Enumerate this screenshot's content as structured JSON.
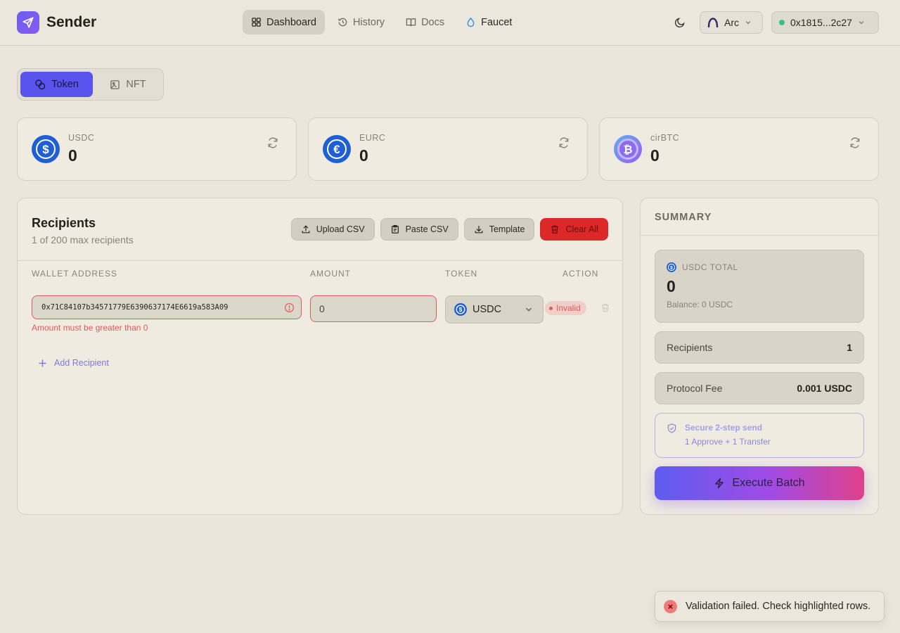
{
  "app": {
    "name": "Sender"
  },
  "nav": [
    {
      "label": "Dashboard",
      "icon": "grid-icon",
      "active": true
    },
    {
      "label": "History",
      "icon": "history-icon"
    },
    {
      "label": "Docs",
      "icon": "book-icon"
    },
    {
      "label": "Faucet",
      "icon": "droplet-icon"
    }
  ],
  "header": {
    "network": "Arc",
    "wallet": "0x1815...2c27",
    "wallet_status_color": "#34c77b"
  },
  "mode": {
    "token": "Token",
    "nft": "NFT",
    "selected": "Token"
  },
  "balances": [
    {
      "symbol": "USDC",
      "value": "0",
      "color": "#1f5fd6"
    },
    {
      "symbol": "EURC",
      "value": "0",
      "color": "#1f5fd6"
    },
    {
      "symbol": "cirBTC",
      "value": "0",
      "color": "#8a6cf0"
    }
  ],
  "recipients": {
    "title": "Recipients",
    "subtitle": "1 of 200 max recipients",
    "actions": {
      "upload": "Upload CSV",
      "paste": "Paste CSV",
      "template": "Template",
      "clear": "Clear All"
    },
    "columns": {
      "address": "WALLET ADDRESS",
      "amount": "AMOUNT",
      "token": "TOKEN",
      "action": "ACTION"
    },
    "rows": [
      {
        "address": "0x71C84107b34571779E6390637174E6619a583A09",
        "amount": "0",
        "token": "USDC",
        "status": "Invalid",
        "error": "Amount must be greater than 0"
      }
    ],
    "add_label": "Add Recipient"
  },
  "summary": {
    "title": "SUMMARY",
    "total_label": "USDC TOTAL",
    "total_value": "0",
    "balance_text": "Balance: 0 USDC",
    "recipients_label": "Recipients",
    "recipients_value": "1",
    "fee_label": "Protocol Fee",
    "fee_value": "0.001 USDC",
    "secure_title": "Secure 2-step send",
    "secure_sub": "1 Approve + 1 Transfer",
    "execute": "Execute Batch"
  },
  "toast": {
    "message": "Validation failed. Check highlighted rows."
  },
  "colors": {
    "accent": "#5b53ee",
    "danger": "#dc2828",
    "error": "#e05a5a"
  }
}
